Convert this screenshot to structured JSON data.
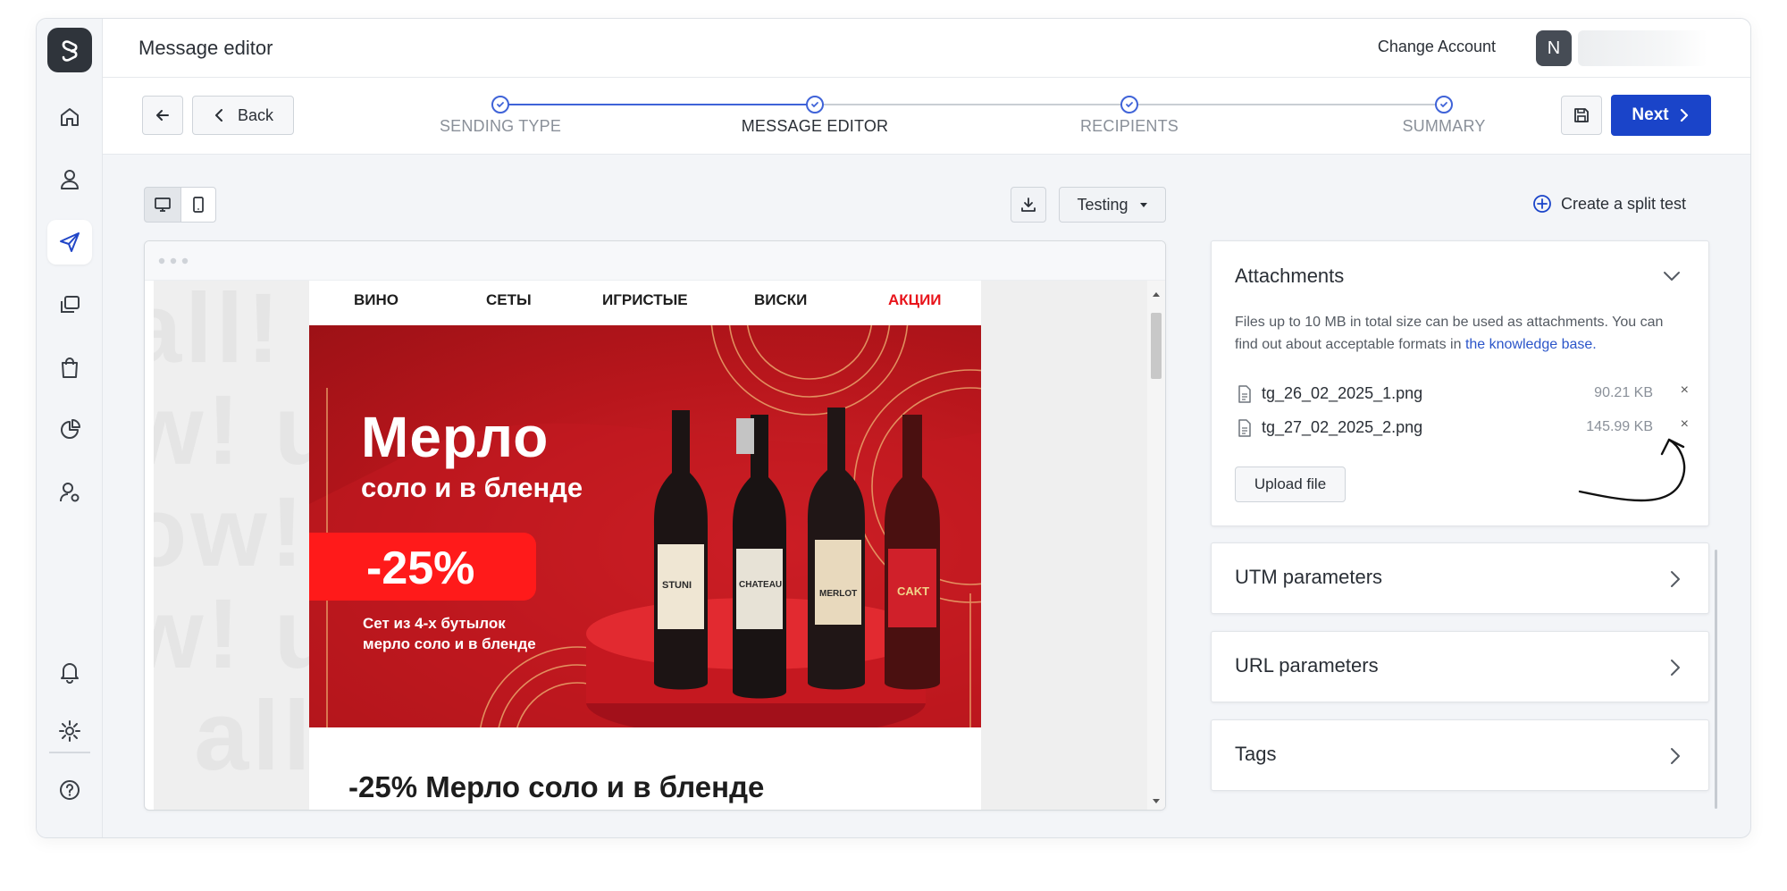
{
  "header": {
    "title": "Message editor",
    "change_account": "Change Account",
    "avatar_initial": "N"
  },
  "toolbar": {
    "back_label": "Back",
    "next_label": "Next",
    "testing_label": "Testing",
    "split_test_label": "Create a split test"
  },
  "steps": [
    {
      "label": "SENDING TYPE",
      "state": "done"
    },
    {
      "label": "MESSAGE EDITOR",
      "state": "current"
    },
    {
      "label": "RECIPIENTS",
      "state": "done"
    },
    {
      "label": "SUMMARY",
      "state": "done"
    }
  ],
  "sidebar": {
    "items": [
      {
        "icon": "home-icon"
      },
      {
        "icon": "user-icon"
      },
      {
        "icon": "send-icon",
        "active": true
      },
      {
        "icon": "templates-icon"
      },
      {
        "icon": "shopping-bag-icon"
      },
      {
        "icon": "pie-chart-icon"
      },
      {
        "icon": "user-settings-icon"
      },
      {
        "icon": "bell-icon"
      },
      {
        "icon": "gear-icon"
      },
      {
        "icon": "help-icon"
      }
    ]
  },
  "preview": {
    "nav": [
      "ВИНО",
      "СЕТЫ",
      "ИГРИСТЫЕ",
      "ВИСКИ",
      "АКЦИИ"
    ],
    "banner_title": "Мерло",
    "banner_subtitle": "соло и в бленде",
    "discount": "-25%",
    "banner_desc_line1": "Сет из 4-х бутылок",
    "banner_desc_line2": "мерло соло и в бленде",
    "bottle_labels": [
      "STUNI",
      "CHATEAU",
      "MERLOT",
      "CAKT"
    ],
    "heading": "-25% Мерло соло и в бленде",
    "bg_text_lines": [
      "all! a",
      "w! un",
      "ow! ",
      "! all!"
    ]
  },
  "attachments": {
    "title": "Attachments",
    "desc_part1": "Files up to 10 MB in total size can be used as attachments. You can find out about acceptable formats in ",
    "desc_link": "the knowledge base.",
    "files": [
      {
        "name": "tg_26_02_2025_1.png",
        "size": "90.21 KB"
      },
      {
        "name": "tg_27_02_2025_2.png",
        "size": "145.99 KB"
      }
    ],
    "remove_glyph": "×",
    "upload_label": "Upload file"
  },
  "panels": {
    "utm": "UTM parameters",
    "url": "URL parameters",
    "tags": "Tags"
  },
  "colors": {
    "accent": "#1a44c9",
    "step_line": "#3f63d8",
    "sale_red": "#ff1a1a",
    "link": "#2b55c9"
  }
}
